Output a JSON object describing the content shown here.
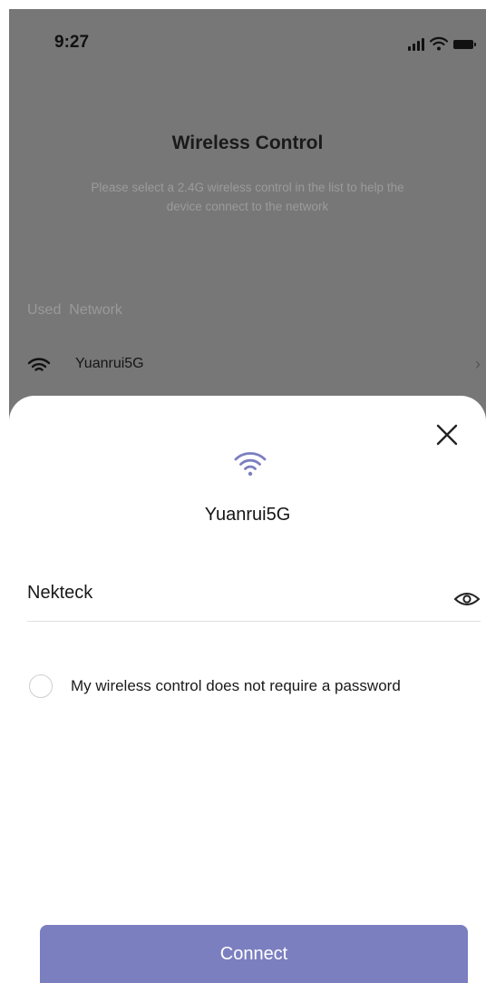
{
  "status_bar": {
    "time": "9:27"
  },
  "background_screen": {
    "title": "Wireless Control",
    "subtitle": "Please select a 2.4G wireless control in the list to help the device connect to the network",
    "section_label": "Used  Network",
    "network": {
      "name": "Yuanrui5G",
      "chevron": "›"
    }
  },
  "sheet": {
    "network_name": "Yuanrui5G",
    "password_value": "Nekteck",
    "no_password_label": "My wireless control does not require a password",
    "no_password_checked": false,
    "connect_label": "Connect"
  },
  "icons": {
    "status": [
      "signal-icon",
      "wifi-icon",
      "battery-icon"
    ],
    "network_row": "wifi-icon",
    "sheet": [
      "close-icon",
      "wifi-icon",
      "eye-icon"
    ]
  },
  "colors": {
    "accent": "#7b7fc0",
    "wifi_accent": "#7b7fc0",
    "dim_overlay": "#777777"
  }
}
